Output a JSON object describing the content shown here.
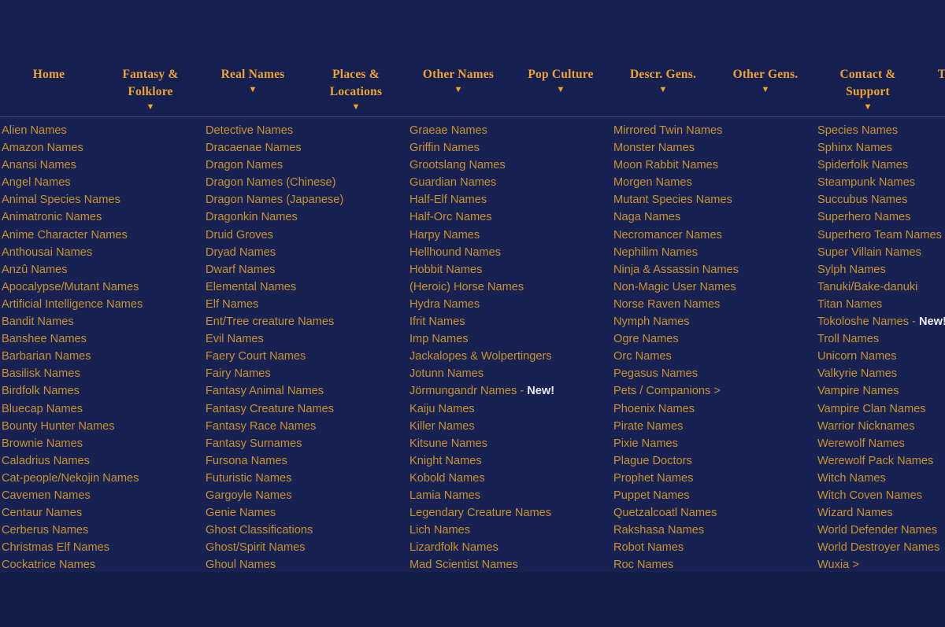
{
  "theme": {
    "page_bg": "#141d46",
    "nav_bg": "#162050",
    "dropdown_bg": "#182252",
    "nav_label_color": "#f0a430",
    "link_color": "#c8922f",
    "new_badge_color": "#e8eaf4",
    "divider_color": "#3c4880"
  },
  "nav": {
    "items": [
      {
        "label": "Home",
        "label2": "",
        "caret": ""
      },
      {
        "label": "Fantasy &",
        "label2": "Folklore",
        "caret": "▼"
      },
      {
        "label": "Real Names",
        "label2": "",
        "caret": "▼"
      },
      {
        "label": "Places &",
        "label2": "Locations",
        "caret": "▼"
      },
      {
        "label": "Other Names",
        "label2": "",
        "caret": "▼"
      },
      {
        "label": "Pop Culture",
        "label2": "",
        "caret": "▼"
      },
      {
        "label": "Descr. Gens.",
        "label2": "",
        "caret": "▼"
      },
      {
        "label": "Other Gens.",
        "label2": "",
        "caret": "▼"
      },
      {
        "label": "Contact &",
        "label2": "Support",
        "caret": "▼"
      },
      {
        "label": "T",
        "label2": "",
        "caret": ""
      }
    ]
  },
  "dropdown": {
    "open_for": "Fantasy & Folklore",
    "columns": [
      {
        "links": [
          "Alien Names",
          "Amazon Names",
          "Anansi Names",
          "Angel Names",
          "Animal Species Names",
          "Animatronic Names",
          "Anime Character Names",
          "Anthousai Names",
          "Anzû Names",
          "Apocalypse/Mutant Names",
          "Artificial Intelligence Names",
          "Bandit Names",
          "Banshee Names",
          "Barbarian Names",
          "Basilisk Names",
          "Birdfolk Names",
          "Bluecap Names",
          "Bounty Hunter Names",
          "Brownie Names",
          "Caladrius Names",
          "Cat-people/Nekojin Names",
          "Cavemen Names",
          "Centaur Names",
          "Cerberus Names",
          "Christmas Elf Names",
          "Cockatrice Names"
        ]
      },
      {
        "links": [
          "Detective Names",
          "Dracaenae Names",
          "Dragon Names",
          "Dragon Names (Chinese)",
          "Dragon Names (Japanese)",
          "Dragonkin Names",
          "Druid Groves",
          "Dryad Names",
          "Dwarf Names",
          "Elemental Names",
          "Elf Names",
          "Ent/Tree creature Names",
          "Evil Names",
          "Faery Court Names",
          "Fairy Names",
          "Fantasy Animal Names",
          "Fantasy Creature Names",
          "Fantasy Race Names",
          "Fantasy Surnames",
          "Fursona Names",
          "Futuristic Names",
          "Gargoyle Names",
          "Genie Names",
          "Ghost Classifications",
          "Ghost/Spirit Names",
          "Ghoul Names"
        ]
      },
      {
        "links": [
          "Graeae Names",
          "Griffin Names",
          "Grootslang Names",
          "Guardian Names",
          "Half-Elf Names",
          "Half-Orc Names",
          "Harpy Names",
          "Hellhound Names",
          "Hobbit Names",
          "(Heroic) Horse Names",
          "Hydra Names",
          "Ifrit Names",
          "Imp Names",
          "Jackalopes & Wolpertingers",
          "Jotunn Names",
          "Jörmungandr Names - New!",
          "Kaiju Names",
          "Killer Names",
          "Kitsune Names",
          "Knight Names",
          "Kobold Names",
          "Lamia Names",
          "Legendary Creature Names",
          "Lich Names",
          "Lizardfolk Names",
          "Mad Scientist Names"
        ]
      },
      {
        "links": [
          "Mirrored Twin Names",
          "Monster Names",
          "Moon Rabbit Names",
          "Morgen Names",
          "Mutant Species Names",
          "Naga Names",
          "Necromancer Names",
          "Nephilim Names",
          "Ninja & Assassin Names",
          "Non-Magic User Names",
          "Norse Raven Names",
          "Nymph Names",
          "Ogre Names",
          "Orc Names",
          "Pegasus Names",
          "Pets / Companions >",
          "Phoenix Names",
          "Pirate Names",
          "Pixie Names",
          "Plague Doctors",
          "Prophet Names",
          "Puppet Names",
          "Quetzalcoatl Names",
          "Rakshasa Names",
          "Robot Names",
          "Roc Names"
        ]
      },
      {
        "links": [
          "Species Names",
          "Sphinx Names",
          "Spiderfolk Names",
          "Steampunk Names",
          "Succubus Names",
          "Superhero Names",
          "Superhero Team Names",
          "Super Villain Names",
          "Sylph Names",
          "Tanuki/Bake-danuki",
          "Titan Names",
          "Tokoloshe Names - New!",
          "Troll Names",
          "Unicorn Names",
          "Valkyrie Names",
          "Vampire Names",
          "Vampire Clan Names",
          "Warrior Nicknames",
          "Werewolf Names",
          "Werewolf Pack Names",
          "Witch Names",
          "Witch Coven Names",
          "Wizard Names",
          "World Defender Names",
          "World Destroyer Names",
          "Wuxia >"
        ]
      }
    ]
  }
}
